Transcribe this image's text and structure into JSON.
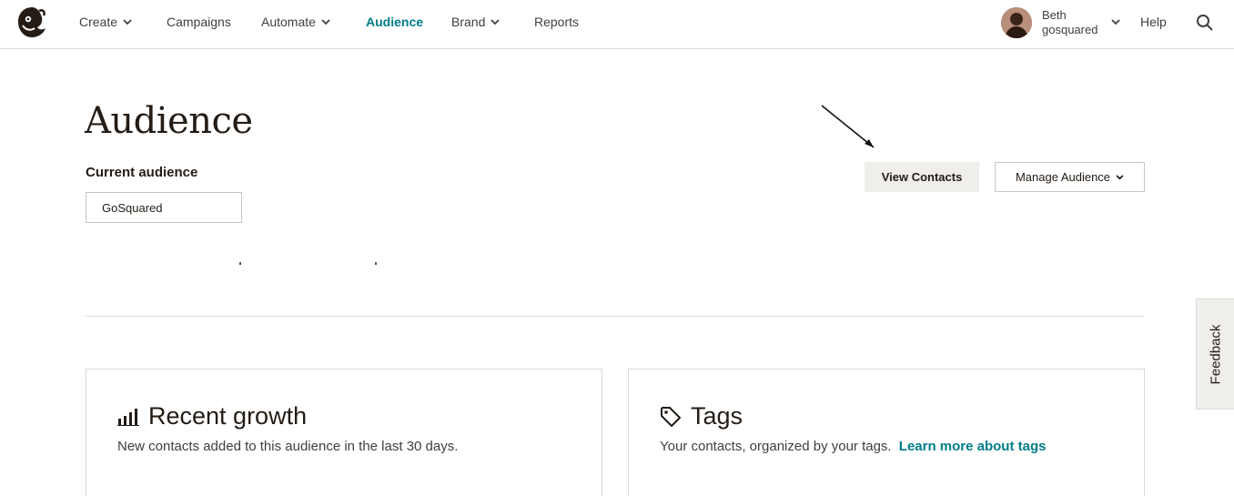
{
  "nav": {
    "items": [
      {
        "label": "Create",
        "has_dropdown": true,
        "active": false
      },
      {
        "label": "Campaigns",
        "has_dropdown": false,
        "active": false
      },
      {
        "label": "Automate",
        "has_dropdown": true,
        "active": false
      },
      {
        "label": "Audience",
        "has_dropdown": false,
        "active": true
      },
      {
        "label": "Brand",
        "has_dropdown": true,
        "active": false
      },
      {
        "label": "Reports",
        "has_dropdown": false,
        "active": false
      }
    ],
    "user": {
      "first": "Beth",
      "second": "gosquared"
    },
    "help_label": "Help",
    "search_icon": "search-icon",
    "logo_icon": "mailchimp-logo-icon"
  },
  "page": {
    "title": "Audience",
    "current_audience_label": "Current audience",
    "current_audience_value": "GoSquared",
    "view_contacts_label": "View Contacts",
    "manage_audience_label": "Manage Audience"
  },
  "cards": {
    "growth": {
      "title": "Recent growth",
      "description": "New contacts added to this audience in the last 30 days.",
      "icon": "bar-chart-icon"
    },
    "tags": {
      "title": "Tags",
      "description": "Your contacts, organized by your tags.",
      "link": "Learn more about tags",
      "icon": "tag-icon"
    }
  },
  "feedback_label": "Feedback",
  "colors": {
    "accent": "#007c89",
    "text": "#241c15",
    "button_secondary_bg": "#efeeea"
  }
}
